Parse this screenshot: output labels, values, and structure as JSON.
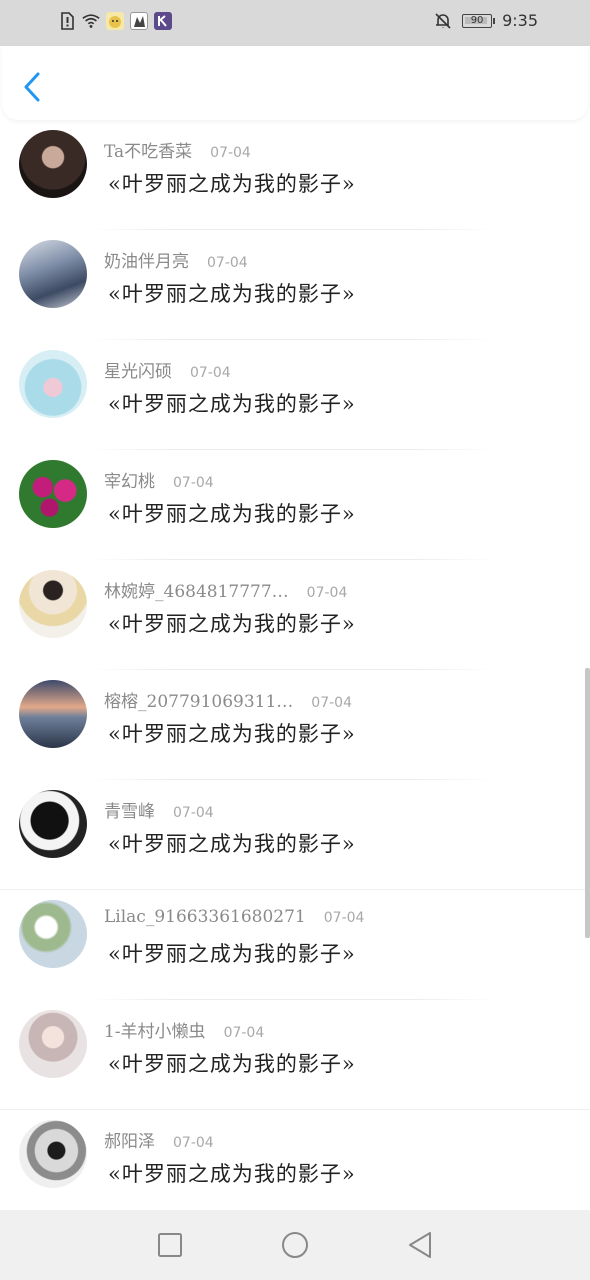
{
  "status_bar": {
    "battery_level": "90",
    "time": "9:35",
    "icons": [
      "alert-icon",
      "wifi-icon",
      "app-icon-1",
      "app-icon-2",
      "k-app-icon",
      "mute-bell-icon",
      "battery-icon"
    ]
  },
  "header": {
    "back_icon": "chevron-left-icon",
    "accent_color": "#2196F3"
  },
  "comments": [
    {
      "name": "Ta不吃香菜",
      "date": "07-04",
      "text": "«叶罗丽之成为我的影子»"
    },
    {
      "name": "奶油伴月亮",
      "date": "07-04",
      "text": "«叶罗丽之成为我的影子»"
    },
    {
      "name": "星光闪硕",
      "date": "07-04",
      "text": "«叶罗丽之成为我的影子»"
    },
    {
      "name": "宰幻桃",
      "date": "07-04",
      "text": "«叶罗丽之成为我的影子»"
    },
    {
      "name": "林婉婷_4684817777…",
      "date": "07-04",
      "text": "«叶罗丽之成为我的影子»"
    },
    {
      "name": "榕榕_207791069311…",
      "date": "07-04",
      "text": "«叶罗丽之成为我的影子»"
    },
    {
      "name": "青雪峰",
      "date": "07-04",
      "text": "«叶罗丽之成为我的影子»"
    },
    {
      "name": "Lilac_91663361680271",
      "date": "07-04",
      "text": "«叶罗丽之成为我的影子»"
    },
    {
      "name": "1-羊村小懒虫",
      "date": "07-04",
      "text": "«叶罗丽之成为我的影子»"
    },
    {
      "name": "郝阳泽",
      "date": "07-04",
      "text": "«叶罗丽之成为我的影子»"
    }
  ],
  "nav_bar": {
    "icons": [
      "recent-apps-icon",
      "home-icon",
      "back-triangle-icon"
    ]
  }
}
